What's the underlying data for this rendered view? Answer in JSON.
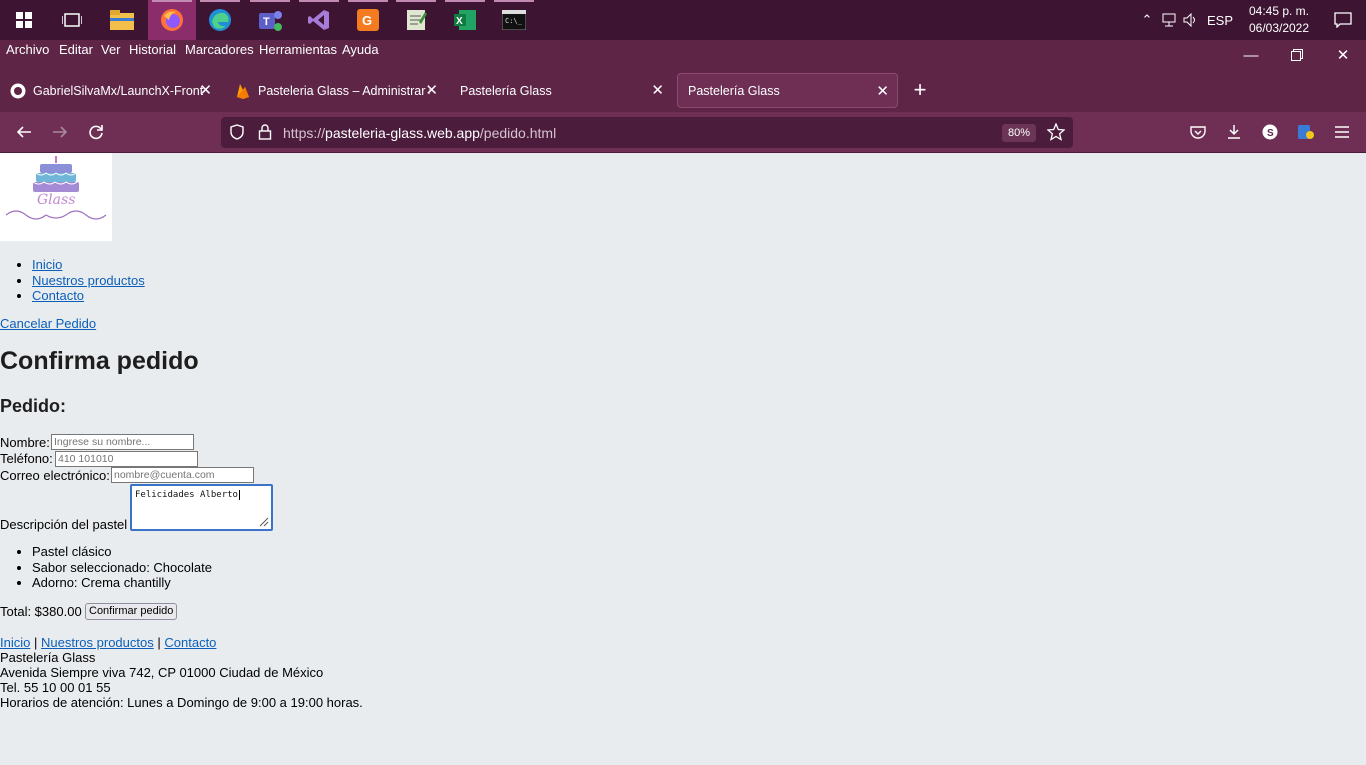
{
  "taskbar": {
    "apps": [
      "windows-start",
      "task-view",
      "file-explorer",
      "firefox",
      "edge",
      "teams",
      "visual-studio",
      "pdf-app",
      "notepad",
      "excel",
      "terminal"
    ],
    "language": "ESP",
    "time": "04:45 p. m.",
    "date": "06/03/2022"
  },
  "menubar": {
    "items": [
      "Archivo",
      "Editar",
      "Ver",
      "Historial",
      "Marcadores",
      "Herramientas",
      "Ayuda"
    ]
  },
  "tabs": [
    {
      "title": "GabrielSilvaMx/LaunchX-Fronte",
      "icon": "github-icon"
    },
    {
      "title": "Pasteleria Glass – Administrar si",
      "icon": "firebase-icon"
    },
    {
      "title": "Pastelería Glass",
      "icon": ""
    },
    {
      "title": "Pastelería Glass",
      "icon": ""
    }
  ],
  "urlbar": {
    "prefix": "https://",
    "host": "pasteleria-glass.web.app",
    "path": "/pedido.html",
    "zoom": "80%"
  },
  "page": {
    "nav": [
      "Inicio",
      "Nuestros productos",
      "Contacto"
    ],
    "cancel_link": "Cancelar Pedido",
    "title": "Confirma pedido",
    "subtitle": "Pedido:",
    "form": {
      "name_label": "Nombre:",
      "name_placeholder": "Ingrese su nombre...",
      "phone_label": "Teléfono:",
      "phone_placeholder": "410 101010",
      "email_label": "Correo electrónico:",
      "email_placeholder": "nombre@cuenta.com",
      "desc_label": "Descripción del pastel",
      "desc_value": "Felicidades Alberto"
    },
    "details": [
      "Pastel clásico",
      "Sabor seleccionado: Chocolate",
      "Adorno: Crema chantilly"
    ],
    "total": "Total: $380.00",
    "confirm_button": "Confirmar pedido",
    "footer": {
      "links": [
        "Inicio",
        "Nuestros productos",
        "Contacto"
      ],
      "separator": "|",
      "name": "Pastelería Glass",
      "address": "Avenida Siempre viva 742, CP 01000 Ciudad de México",
      "phone": "Tel. 55 10 00 01 55",
      "hours": "Horarios de atención: Lunes a Domingo de 9:00 a 19:00 horas."
    },
    "logo_text": "Glass"
  }
}
